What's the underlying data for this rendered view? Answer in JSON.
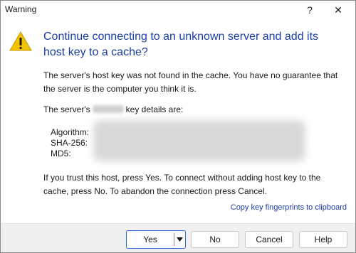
{
  "window": {
    "title": "Warning",
    "help_symbol": "?",
    "close_symbol": "✕"
  },
  "message": {
    "headline": "Continue connecting to an unknown server and add its host key to a cache?",
    "paragraph1": "The server's host key was not found in the cache. You have no guarantee that the server is the computer you think it is.",
    "key_details_prefix": "The server's",
    "key_details_suffix": "key details are:",
    "paragraph3": "If you trust this host, press Yes. To connect without adding host key to the cache, press No. To abandon the connection press Cancel."
  },
  "details": {
    "labels": [
      "Algorithm:",
      "SHA-256:",
      "MD5:"
    ]
  },
  "link": {
    "copy_fingerprints": "Copy key fingerprints to clipboard"
  },
  "buttons": {
    "yes": "Yes",
    "no": "No",
    "cancel": "Cancel",
    "help": "Help"
  },
  "icons": {
    "warning": "warning-triangle-icon",
    "dropdown": "dropdown-arrow-icon"
  },
  "colors": {
    "headline": "#1a3ea6",
    "link": "#1a3ea6",
    "warning_fill": "#f2c200",
    "default_button_border": "#2b6ad6"
  }
}
